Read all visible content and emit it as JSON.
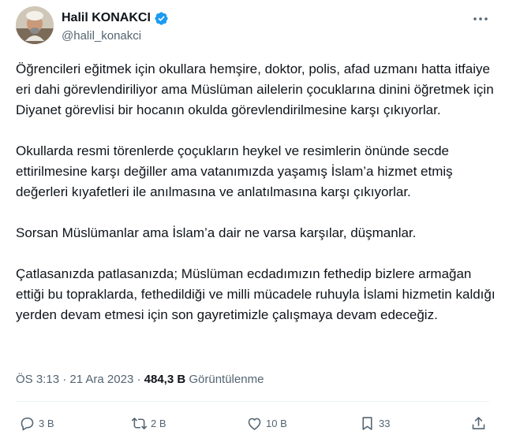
{
  "author": {
    "display_name": "Halil KONAKCI",
    "handle": "@halil_konakci",
    "verified": true,
    "verified_color": "#1d9bf0"
  },
  "icons": {
    "more": "more-horizontal-icon",
    "verified": "verified-badge-icon",
    "reply": "reply-icon",
    "retweet": "retweet-icon",
    "like": "heart-icon",
    "bookmark": "bookmark-icon",
    "share": "share-icon"
  },
  "tweet": {
    "paragraphs": [
      "Öğrencileri eğitmek için okullara hemşire, doktor, polis, afad uzmanı hatta itfaiye eri dahi görevlendiriliyor ama Müslüman ailelerin çocuklarına dinini öğretmek için Diyanet görevlisi bir hocanın okulda görevlendirilmesine karşı çıkıyorlar.",
      "Okullarda resmi törenlerde çoçukların heykel ve resimlerin önünde secde ettirilmesine karşı değiller ama vatanımızda yaşamış İslam’a hizmet etmiş değerleri kıyafetleri ile anılmasına ve anlatılmasına karşı çıkıyorlar.",
      "Sorsan Müslümanlar ama İslam’a dair ne varsa karşılar, düşmanlar.",
      "Çatlasanızda patlasanızda; Müslüman ecdadımızın fethedip bizlere armağan ettiği bu topraklarda, fethedildiği ve milli mücadele ruhuyla İslami hizmetin kaldığı yerden devam etmesi için son gayretimizle çalışmaya devam edeceğiz."
    ]
  },
  "meta": {
    "time": "ÖS 3:13",
    "separator": "·",
    "date": "21 Ara 2023",
    "views": "484,3 B",
    "views_label": "Görüntülenme"
  },
  "actions": {
    "replies": "3 B",
    "retweets": "2 B",
    "likes": "10 B",
    "bookmarks": "33"
  }
}
